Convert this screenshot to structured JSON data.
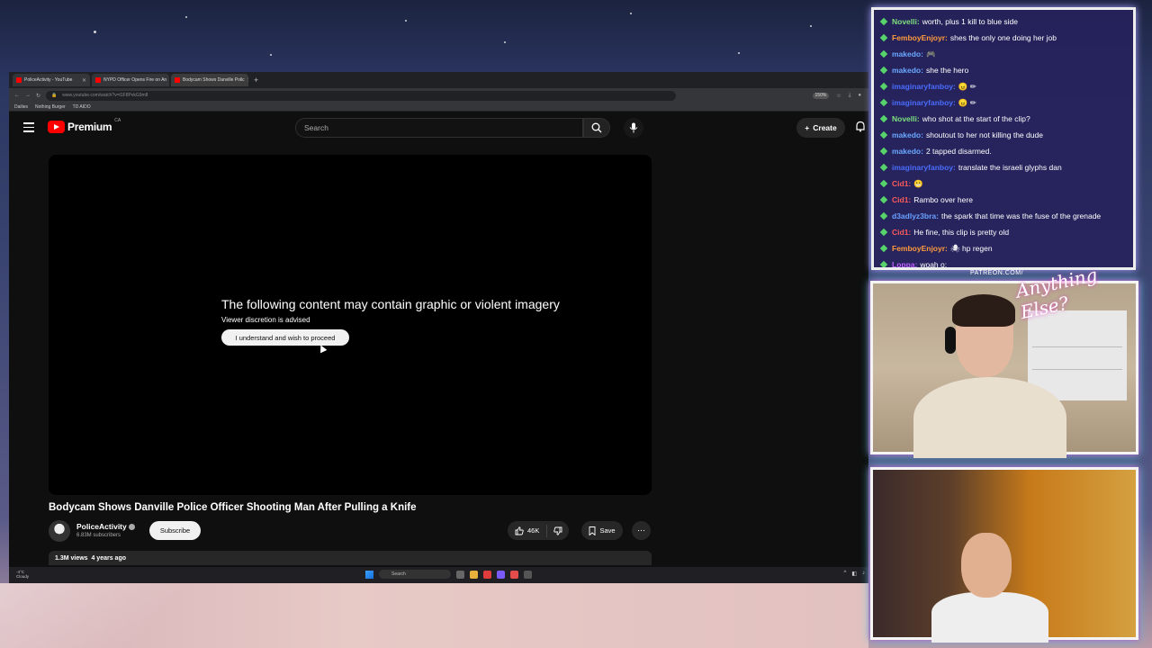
{
  "browser": {
    "tabs": [
      {
        "label": "PoliceActivity - YouTube",
        "active": false
      },
      {
        "label": "NYPD Officer Opens Fire on An",
        "active": false
      },
      {
        "label": "Bodycam Shows Danville Polic",
        "active": true
      }
    ],
    "url": "www.youtube.com/watch?v=t1F8PvkG9m8",
    "zoom": "150%",
    "bookmarks": [
      "Dailies",
      "Nothing Burger",
      "TD AIDO"
    ]
  },
  "youtube": {
    "logo_text": "Premium",
    "logo_region": "CA",
    "search_placeholder": "Search",
    "create_label": "Create"
  },
  "player": {
    "warning_title": "The following content may contain graphic or violent imagery",
    "warning_sub": "Viewer discretion is advised",
    "proceed_label": "I understand and wish to proceed"
  },
  "video": {
    "title": "Bodycam Shows Danville Police Officer Shooting Man After Pulling a Knife",
    "channel_name": "PoliceActivity",
    "subscribers": "6.83M subscribers",
    "subscribe_label": "Subscribe",
    "likes": "46K",
    "save_label": "Save",
    "views": "1.3M views",
    "age": "4 years ago"
  },
  "taskbar": {
    "weather_temp": "-4°C",
    "weather_desc": "Cloudy",
    "search_label": "Search"
  },
  "chat": {
    "messages": [
      {
        "user": "Novelli:",
        "color": "#7ee07e",
        "text": "worth, plus 1 kill to blue side"
      },
      {
        "user": "FemboyEnjoyr:",
        "color": "#ff9a3c",
        "text": "shes the only one doing her job"
      },
      {
        "user": "makedo:",
        "color": "#6aa9ff",
        "text": "🎮"
      },
      {
        "user": "makedo:",
        "color": "#6aa9ff",
        "text": "she the hero"
      },
      {
        "user": "imaginaryfanboy:",
        "color": "#4a6dff",
        "text": "😠 ✏"
      },
      {
        "user": "imaginaryfanboy:",
        "color": "#4a6dff",
        "text": "😠 ✏"
      },
      {
        "user": "Novelli:",
        "color": "#7ee07e",
        "text": "who shot at the start of the clip?"
      },
      {
        "user": "makedo:",
        "color": "#6aa9ff",
        "text": "shoutout to her not killing the dude"
      },
      {
        "user": "makedo:",
        "color": "#6aa9ff",
        "text": "2 tapped disarmed."
      },
      {
        "user": "imaginaryfanboy:",
        "color": "#4a6dff",
        "text": "translate the israeli glyphs dan"
      },
      {
        "user": "Cid1:",
        "color": "#ff5a5a",
        "text": "😬"
      },
      {
        "user": "Cid1:",
        "color": "#ff5a5a",
        "text": "Rambo over here"
      },
      {
        "user": "d3adlyz3bra:",
        "color": "#6aa0ff",
        "text": "the spark that time was the fuse of the grenade"
      },
      {
        "user": "Cid1:",
        "color": "#ff5a5a",
        "text": "He fine, this clip is pretty old"
      },
      {
        "user": "FemboyEnjoyr:",
        "color": "#ff9a3c",
        "text": "🕷 hp regen"
      },
      {
        "user": "Loppa:",
        "color": "#c060ff",
        "text": "woah o:"
      }
    ]
  },
  "overlay": {
    "patreon": "PATREON.COM/",
    "signature": "Anything Else?"
  }
}
